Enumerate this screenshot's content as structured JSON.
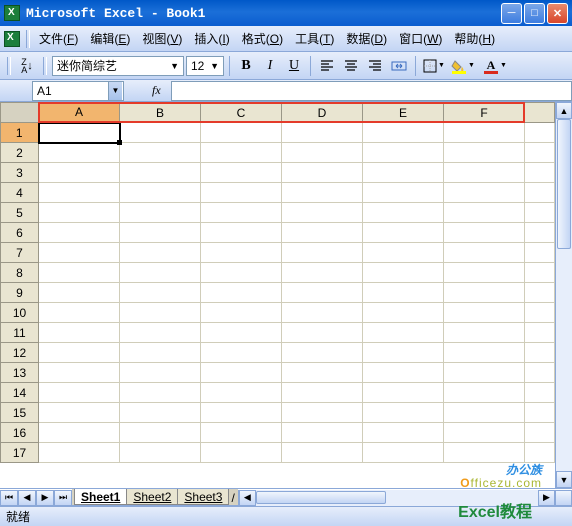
{
  "title": "Microsoft Excel - Book1",
  "menus": [
    {
      "label": "文件",
      "hk": "F"
    },
    {
      "label": "编辑",
      "hk": "E"
    },
    {
      "label": "视图",
      "hk": "V"
    },
    {
      "label": "插入",
      "hk": "I"
    },
    {
      "label": "格式",
      "hk": "O"
    },
    {
      "label": "工具",
      "hk": "T"
    },
    {
      "label": "数据",
      "hk": "D"
    },
    {
      "label": "窗口",
      "hk": "W"
    },
    {
      "label": "帮助",
      "hk": "H"
    }
  ],
  "sort_label": "Z↓A",
  "font_name": "迷你简综艺",
  "font_size": "12",
  "namebox": "A1",
  "fx_label": "fx",
  "columns": [
    "A",
    "B",
    "C",
    "D",
    "E",
    "F"
  ],
  "rows": [
    "1",
    "2",
    "3",
    "4",
    "5",
    "6",
    "7",
    "8",
    "9",
    "10",
    "11",
    "12",
    "13",
    "14",
    "15",
    "16",
    "17"
  ],
  "selected_col": "A",
  "selected_row": "1",
  "sheets": [
    "Sheet1",
    "Sheet2",
    "Sheet3"
  ],
  "active_sheet": "Sheet1",
  "status": "就绪",
  "watermark": {
    "brand": "办公族",
    "suffix_o": "O",
    "url": "fficezu.com",
    "tutorial": "Excel教程"
  }
}
